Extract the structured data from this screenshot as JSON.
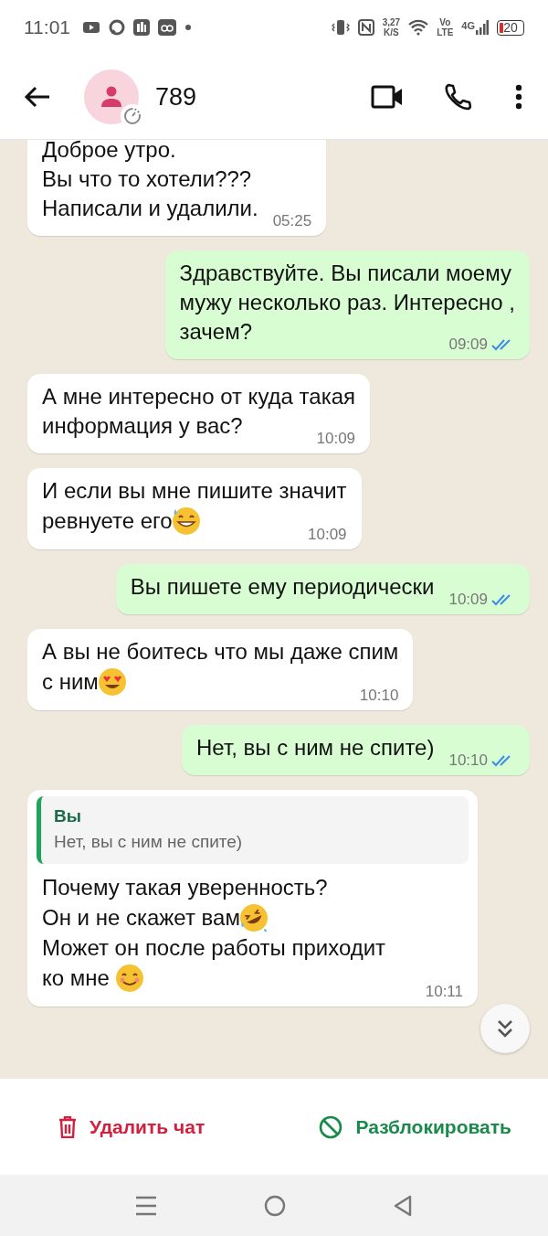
{
  "status_bar": {
    "time": "11:01",
    "speed_value": "3,27",
    "speed_unit": "K/S",
    "volte_top": "Vo",
    "volte_bottom": "LTE",
    "network": "4G",
    "battery": "20"
  },
  "header": {
    "contact_name": "789"
  },
  "messages": [
    {
      "kind": "incoming",
      "lines": [
        {
          "kind": "plain",
          "text": "Доброе утро."
        },
        {
          "kind": "plain",
          "text": "Вы что то хотели???"
        },
        {
          "kind": "plain",
          "text": "Написали и удалили."
        }
      ],
      "time": "05:25"
    },
    {
      "kind": "outgoing",
      "lines": [
        {
          "kind": "plain",
          "text": "Здравствуйте. Вы писали моему"
        },
        {
          "kind": "plain",
          "text": "мужу несколько раз. Интересно ,"
        },
        {
          "kind": "plain",
          "text": "зачем?"
        }
      ],
      "time": "09:09",
      "read": true
    },
    {
      "kind": "incoming",
      "lines": [
        {
          "kind": "plain",
          "text": "А мне интересно от куда такая"
        },
        {
          "kind": "plain",
          "text": "информация у вас?"
        }
      ],
      "time": "10:09"
    },
    {
      "kind": "incoming",
      "lines": [
        {
          "kind": "plain",
          "text": "И если вы мне пишите значит"
        },
        {
          "kind": "sweat",
          "text": "ревнуете его"
        }
      ],
      "time": "10:09"
    },
    {
      "kind": "outgoing",
      "lines": [
        {
          "kind": "plain",
          "text": "Вы пишете ему периодически"
        }
      ],
      "time": "10:09",
      "read": true
    },
    {
      "kind": "incoming",
      "lines": [
        {
          "kind": "plain",
          "text": "А вы не боитесь что мы даже спим"
        },
        {
          "kind": "hearts",
          "text": "с ним"
        }
      ],
      "time": "10:10"
    },
    {
      "kind": "outgoing",
      "lines": [
        {
          "kind": "plain",
          "text": "Нет, вы с ним не спите)"
        }
      ],
      "time": "10:10",
      "read": true
    },
    {
      "kind": "incoming",
      "quote": {
        "author": "Вы",
        "text": "Нет, вы с ним не спите)"
      },
      "lines": [
        {
          "kind": "plain",
          "text": "Почему такая уверенность?"
        },
        {
          "kind": "rofl",
          "text": "Он и не скажет вам"
        },
        {
          "kind": "plain",
          "text": "Может он после работы приходит"
        },
        {
          "kind": "smile",
          "text": "ко мне "
        }
      ],
      "time": "10:11"
    }
  ],
  "actions": [
    {
      "kind": "delete",
      "label": "Удалить чат"
    },
    {
      "kind": "unblock",
      "label": "Разблокировать"
    }
  ]
}
